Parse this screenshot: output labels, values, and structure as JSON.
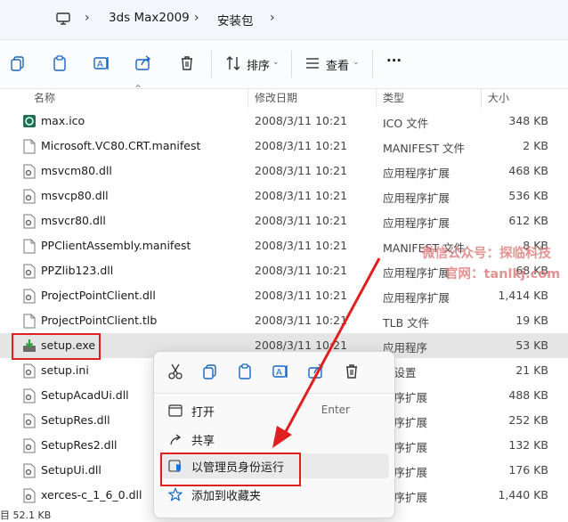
{
  "breadcrumb": {
    "items": [
      "3ds Max2009",
      "安装包"
    ]
  },
  "toolbar": {
    "sort_label": "排序",
    "view_label": "查看",
    "more_label": "···"
  },
  "columns": {
    "name": "名称",
    "date": "修改日期",
    "type": "类型",
    "size": "大小"
  },
  "files": [
    {
      "name": "max.ico",
      "date": "2008/3/11 10:21",
      "type": "ICO 文件",
      "size": "348 KB"
    },
    {
      "name": "Microsoft.VC80.CRT.manifest",
      "date": "2008/3/11 10:21",
      "type": "MANIFEST 文件",
      "size": "2 KB"
    },
    {
      "name": "msvcm80.dll",
      "date": "2008/3/11 10:21",
      "type": "应用程序扩展",
      "size": "468 KB"
    },
    {
      "name": "msvcp80.dll",
      "date": "2008/3/11 10:21",
      "type": "应用程序扩展",
      "size": "536 KB"
    },
    {
      "name": "msvcr80.dll",
      "date": "2008/3/11 10:21",
      "type": "应用程序扩展",
      "size": "612 KB"
    },
    {
      "name": "PPClientAssembly.manifest",
      "date": "2008/3/11 10:21",
      "type": "MANIFEST 文件",
      "size": "8 KB"
    },
    {
      "name": "PPZlib123.dll",
      "date": "2008/3/11 10:21",
      "type": "应用程序扩展",
      "size": "68 KB"
    },
    {
      "name": "ProjectPointClient.dll",
      "date": "2008/3/11 10:21",
      "type": "应用程序扩展",
      "size": "1,414 KB"
    },
    {
      "name": "ProjectPointClient.tlb",
      "date": "2008/3/11 10:21",
      "type": "TLB 文件",
      "size": "19 KB"
    },
    {
      "name": "setup.exe",
      "date": "2008/3/11 10:21",
      "type": "应用程序",
      "size": "53 KB"
    },
    {
      "name": "setup.ini",
      "date": "",
      "type": "置设置",
      "size": "21 KB"
    },
    {
      "name": "SetupAcadUi.dll",
      "date": "",
      "type": "程序扩展",
      "size": "488 KB"
    },
    {
      "name": "SetupRes.dll",
      "date": "",
      "type": "程序扩展",
      "size": "252 KB"
    },
    {
      "name": "SetupRes2.dll",
      "date": "",
      "type": "程序扩展",
      "size": "132 KB"
    },
    {
      "name": "SetupUi.dll",
      "date": "",
      "type": "程序扩展",
      "size": "176 KB"
    },
    {
      "name": "xerces-c_1_6_0.dll",
      "date": "",
      "type": "程序扩展",
      "size": "1,440 KB"
    }
  ],
  "context_menu": {
    "open_label": "打开",
    "open_shortcut": "Enter",
    "share_label": "共享",
    "run_as_admin_label": "以管理员身份运行",
    "add_favorites_label": "添加到收藏夹"
  },
  "watermark": {
    "line1": "微信公众号：探临科技",
    "line2": "官网：tanlkj.com"
  },
  "status": {
    "text": "目 52.1 KB"
  },
  "colors": {
    "highlight_red": "#e02020",
    "selected_row": "#e5e5e5"
  }
}
